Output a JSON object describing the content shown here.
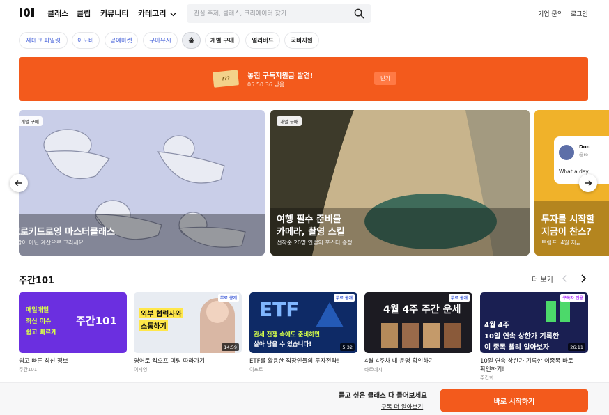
{
  "header": {
    "nav": [
      "클래스",
      "클립",
      "커뮤니티",
      "카테고리"
    ],
    "search_placeholder": "관심 주제, 클래스, 크리에이터 찾기",
    "links": [
      "기업 문의",
      "로그인"
    ]
  },
  "chips": [
    "재테크 파일럿",
    "어도비",
    "공예마켓",
    "구마유시",
    "홈",
    "개별 구매",
    "얼리버드",
    "국비지원"
  ],
  "banner": {
    "ticket": "???",
    "title": "놓친 구독지원금 발견!",
    "timer": "05:50:36 남음",
    "button": "받기"
  },
  "carousel": [
    {
      "tag": "개별 구매",
      "title": "크로키드로잉 마스터클래스",
      "subtitle": "감이 아닌 계산으로 그리세요"
    },
    {
      "tag": "개별 구매",
      "title_lines": [
        "여행 필수 준비물",
        "카메라, 촬영 스킬"
      ],
      "subtitle": "선착순 20명 인썸의 포스터 증정"
    },
    {
      "tag": "개별 구매",
      "title_lines": [
        "투자를 시작할",
        "지금이 찬스?"
      ],
      "subtitle": "트럼프: 4월 지금 ",
      "card_text": [
        "Don",
        "@re",
        "What a day"
      ]
    }
  ],
  "section": {
    "title": "주간101",
    "more": "더 보기"
  },
  "cards": [
    {
      "thumb_lines": [
        "매일매일",
        "최신 이슈",
        "쉽고 빠르게"
      ],
      "thumb_logo": "주간101",
      "title": "쉽고 빠른 최신 정보",
      "author": "주간101",
      "badge": "",
      "duration": ""
    },
    {
      "thumb_lines": [
        "외부 협력사와",
        "소통하기"
      ],
      "thumb_logo": "",
      "title": "영어로 킥오프 미팅 따라가기",
      "author": "이지영",
      "badge": "무료 공개",
      "duration": "14:59"
    },
    {
      "thumb_lines": [
        "관세 전쟁 속에도 준비하면",
        "살아 남을 수 있습니다!"
      ],
      "thumb_logo": "ETF",
      "title": "ETF를 활용한 직장인들의 투자전략!",
      "author": "이프로",
      "badge": "무료 공개",
      "duration": "5:32"
    },
    {
      "thumb_lines": [
        "4월 4주 주간 운세"
      ],
      "thumb_logo": "",
      "title": "4월 4주차 내 운명 확인하기",
      "author": "타로데시",
      "badge": "무료 공개",
      "duration": ""
    },
    {
      "thumb_lines": [
        "4월 4주",
        "10일 연속 상한가 기록한",
        "이 종목 빨리 알아보자"
      ],
      "thumb_logo": "",
      "title": "10일 연속 상한가 기록한 이종목 바로 확인하기!",
      "author": "주긴희",
      "badge": "구독자 전용",
      "duration": "26:11"
    }
  ],
  "bottom": {
    "line1": "듣고 싶은 클래스 다 들어보세요",
    "line2": "구독 더 알아보기",
    "cta": "바로 시작하기"
  }
}
